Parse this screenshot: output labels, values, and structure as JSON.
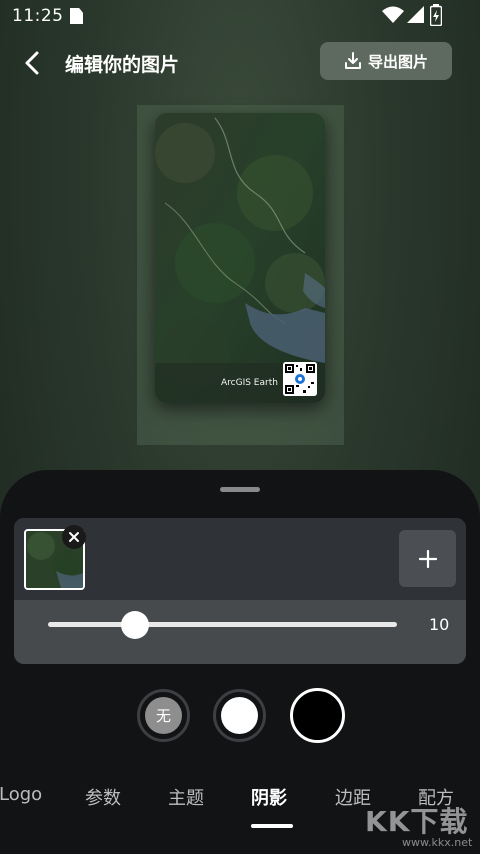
{
  "status": {
    "time": "11:25"
  },
  "header": {
    "title": "编辑你的图片",
    "export_label": "导出图片"
  },
  "preview": {
    "watermark": "ArcGIS Earth"
  },
  "slider": {
    "value": "10",
    "fraction": 0.25
  },
  "shadow_options": {
    "none_label": "无"
  },
  "tabs": [
    "Logo",
    "参数",
    "主题",
    "阴影",
    "边距",
    "配方"
  ],
  "active_tab": "阴影",
  "site_watermark": {
    "main": "KK下载",
    "sub": "www.kkx.net"
  }
}
